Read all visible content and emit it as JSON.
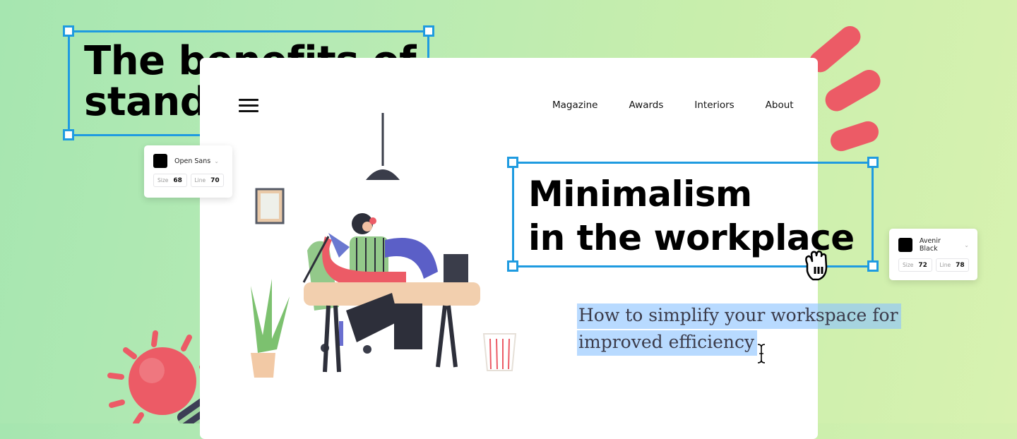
{
  "background_headline": {
    "text": "The benefits of\nstanding"
  },
  "font_panel_left": {
    "font_name": "Open Sans",
    "color": "#000000",
    "size_label": "Size",
    "size_value": "68",
    "line_label": "Line",
    "line_value": "70"
  },
  "font_panel_right": {
    "font_name": "Avenir Black",
    "color": "#000000",
    "size_label": "Size",
    "size_value": "72",
    "line_label": "Line",
    "line_value": "78"
  },
  "page": {
    "nav": [
      "Magazine",
      "Awards",
      "Interiors",
      "About"
    ],
    "headline": "Minimalism\nin the workplace",
    "subtitle": "How to simplify your workspace for improved efficiency"
  },
  "colors": {
    "selection_blue": "#1f9be0",
    "text_highlight": "#a8d2fc",
    "accent_red": "#ef5a64"
  },
  "icons": {
    "menu": "hamburger-menu-icon",
    "hand_cursor": "grab-hand-cursor-icon",
    "text_cursor": "i-beam-cursor-icon",
    "dropdown": "chevron-down-icon"
  }
}
